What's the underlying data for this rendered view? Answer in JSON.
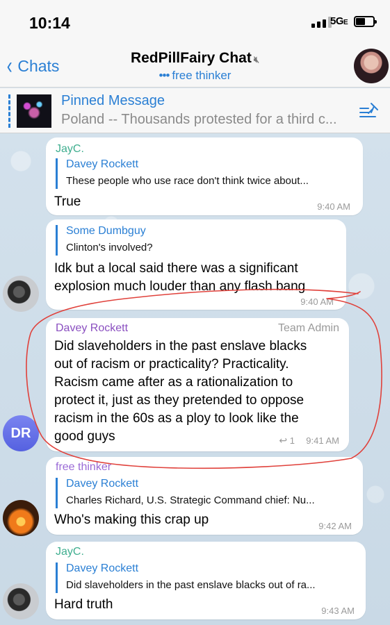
{
  "status_bar": {
    "time": "10:14",
    "network": "5G",
    "network_suffix": "E"
  },
  "nav": {
    "back_label": "Chats",
    "title": "RedPillFairy Chat",
    "subtitle_dots": "•••",
    "subtitle": "free thinker"
  },
  "pinned": {
    "title": "Pinned Message",
    "text": "Poland -- Thousands protested for a third c..."
  },
  "messages": [
    {
      "sender": "JayC.",
      "sender_color": "#3fae8f",
      "reply_name": "Davey Rockett",
      "reply_text": "These people who use race don't think twice about...",
      "text": "True",
      "time": "9:40 AM"
    },
    {
      "reply_name": "Some Dumbguy",
      "reply_text": "Clinton's involved?",
      "text_lines": [
        "Idk but a local said there was a significant",
        "explosion much louder than any flash bang"
      ],
      "time": "9:40 AM"
    },
    {
      "sender": "Davey Rockett",
      "sender_color": "#8a4fc0",
      "role": "Team Admin",
      "text_lines": [
        "Did slaveholders in the past enslave blacks",
        "out of racism or practicality? Practicality.",
        "Racism came after as a rationalization to",
        "protect it, just as they pretended to oppose",
        "racism in the 60s as a ploy to look like the",
        "good guys"
      ],
      "reply_count": "1",
      "time": "9:41 AM",
      "avatar_initials": "DR"
    },
    {
      "sender": "free thinker",
      "sender_color": "#9a6ad6",
      "reply_name": "Davey Rockett",
      "reply_text": "Charles Richard, U.S. Strategic Command chief: Nu...",
      "text": "Who's making this crap up",
      "time": "9:42 AM"
    },
    {
      "sender": "JayC.",
      "sender_color": "#3fae8f",
      "reply_name": "Davey Rockett",
      "reply_text": "Did slaveholders in the past enslave blacks out of ra...",
      "text": "Hard truth",
      "time": "9:43 AM"
    }
  ],
  "colors": {
    "accent": "#2a7fd4",
    "annotation_circle": "#e0413b",
    "background": "#d5e2ec"
  }
}
